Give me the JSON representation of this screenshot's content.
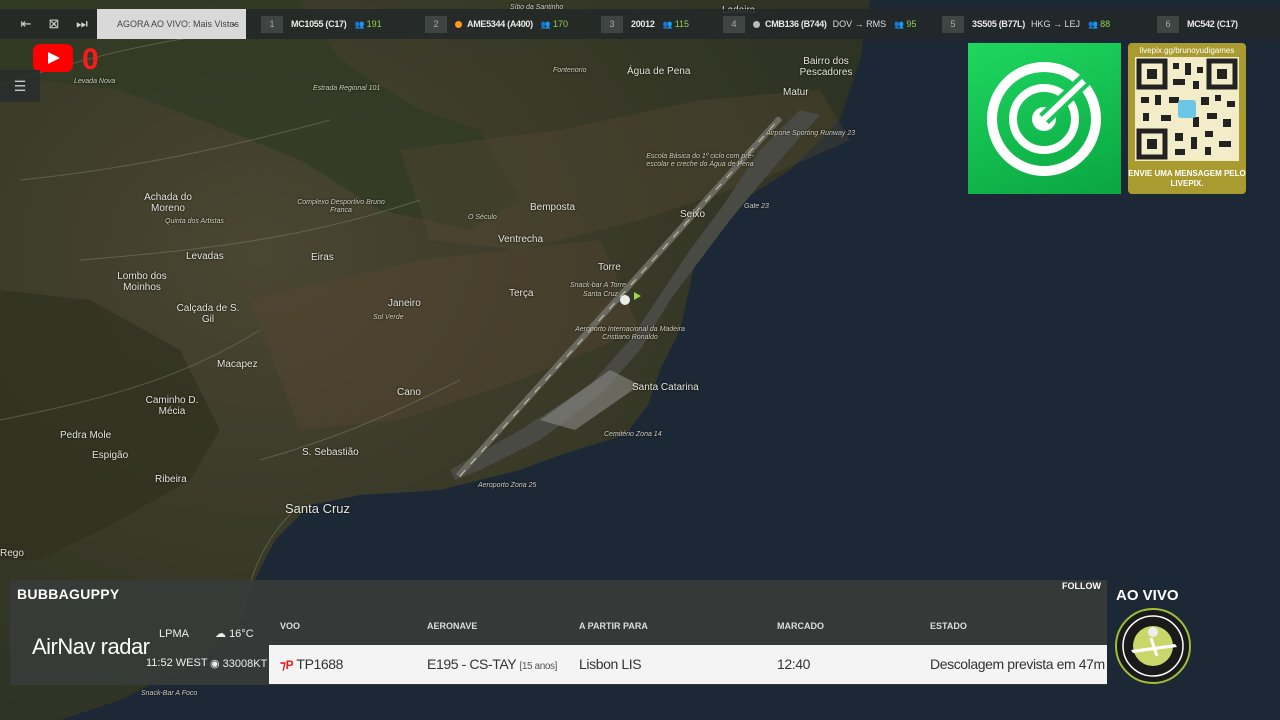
{
  "topbar": {
    "live_select": "AGORA AO VIVO: Mais Vistos",
    "slots": [
      {
        "num": "1",
        "callsign": "MC1055 (C17)",
        "count": "191",
        "route": "",
        "dot": ""
      },
      {
        "num": "2",
        "callsign": "AME5344 (A400)",
        "count": "170",
        "route": "",
        "dot": "#ff9a1a"
      },
      {
        "num": "3",
        "callsign": "20012",
        "count": "115",
        "route": "",
        "dot": ""
      },
      {
        "num": "4",
        "callsign": "CMB136 (B744)",
        "count": "95",
        "route": "DOV → RMS",
        "dot": "#bbbbbb"
      },
      {
        "num": "5",
        "callsign": "3S505 (B77L)",
        "count": "88",
        "route": "HKG → LEJ",
        "dot": ""
      },
      {
        "num": "6",
        "callsign": "MC542 (C17)",
        "count": "",
        "route": "",
        "dot": ""
      }
    ]
  },
  "youtube": {
    "count": "0"
  },
  "map": {
    "labels": [
      {
        "t": "Sítio da Santinho",
        "k": "s"
      },
      {
        "t": "Ladeira",
        "k": "m"
      },
      {
        "t": "Fontenorio",
        "k": "s"
      },
      {
        "t": "Água de Pena",
        "k": "m"
      },
      {
        "t": "Bairro dos Pescadores",
        "k": "m"
      },
      {
        "t": "Matur",
        "k": "m"
      },
      {
        "t": "Airpone Sporting Runway 23",
        "k": "s"
      },
      {
        "t": "Escola Básica do 1º ciclo com pré-escolar e creche do Água de Pena",
        "k": "s"
      },
      {
        "t": "Seixo",
        "k": "m"
      },
      {
        "t": "Gate 23",
        "k": "s"
      },
      {
        "t": "Achada do Moreno",
        "k": "m"
      },
      {
        "t": "Quinta dos Artistas",
        "k": "s"
      },
      {
        "t": "Complexo Desportivo Bruno Franca",
        "k": "s"
      },
      {
        "t": "O Século",
        "k": "s"
      },
      {
        "t": "Bemposta",
        "k": "m"
      },
      {
        "t": "Ventrecha",
        "k": "m"
      },
      {
        "t": "Levadas",
        "k": "m"
      },
      {
        "t": "Eiras",
        "k": "m"
      },
      {
        "t": "Torre",
        "k": "m"
      },
      {
        "t": "Snack-bar A Torre",
        "k": "s"
      },
      {
        "t": "Santa Cruz",
        "k": "s"
      },
      {
        "t": "Lombo dos Moinhos",
        "k": "m"
      },
      {
        "t": "Terça",
        "k": "m"
      },
      {
        "t": "Janeiro",
        "k": "m"
      },
      {
        "t": "Sol Verde",
        "k": "s"
      },
      {
        "t": "Calçada de S. Gil",
        "k": "m"
      },
      {
        "t": "Aeroporto Internacional da Madeira Cristiano Ronaldo",
        "k": "s"
      },
      {
        "t": "Macapez",
        "k": "m"
      },
      {
        "t": "Santa Catarina",
        "k": "m"
      },
      {
        "t": "Cano",
        "k": "m"
      },
      {
        "t": "Caminho D. Mécia",
        "k": "m"
      },
      {
        "t": "Pedra Mole",
        "k": "m"
      },
      {
        "t": "Cemitério Zona 14",
        "k": "s"
      },
      {
        "t": "Espigão",
        "k": "m"
      },
      {
        "t": "S. Sebastião",
        "k": "m"
      },
      {
        "t": "Ribeira",
        "k": "m"
      },
      {
        "t": "Aeroporto Zona 25",
        "k": "s"
      },
      {
        "t": "Santa Cruz",
        "k": "l"
      },
      {
        "t": "Rego",
        "k": "m"
      },
      {
        "t": "Snack-Bar A Foco",
        "k": "s"
      },
      {
        "t": "Levada Nova",
        "k": "s"
      },
      {
        "t": "Estrada Regional 101",
        "k": "s"
      }
    ]
  },
  "qr": {
    "url": "livepix.gg/brunoyudigames",
    "message": "ENVIE UMA MENSAGEM PELO LIVEPIX."
  },
  "flight_panel": {
    "registration": "BUBBAGUPPY",
    "follow": "FOLLOW",
    "brand_main": "AirNav",
    "brand_sub": "radar",
    "airport": "LPMA",
    "time": "11:52 WEST",
    "temp": "16°C",
    "wind": "33008KT",
    "headers": {
      "flight": "VOO",
      "aircraft": "AERONAVE",
      "from_to": "A PARTIR PARA",
      "scheduled": "MARCADO",
      "status": "ESTADO"
    },
    "row": {
      "flight": "TP1688",
      "aircraft": "E195 - CS-TAY",
      "age": "[15 anos]",
      "dest": "Lisbon LIS",
      "scheduled": "12:40",
      "status": "Descolagem prevista em 47m"
    }
  },
  "ao_vivo": "AO VIVO",
  "colors": {
    "ocean": "#1c2733",
    "land": "#3b3a2a",
    "accent_green": "#1ed760",
    "count_green": "#8fd14f",
    "youtube_red": "#ff0000"
  }
}
